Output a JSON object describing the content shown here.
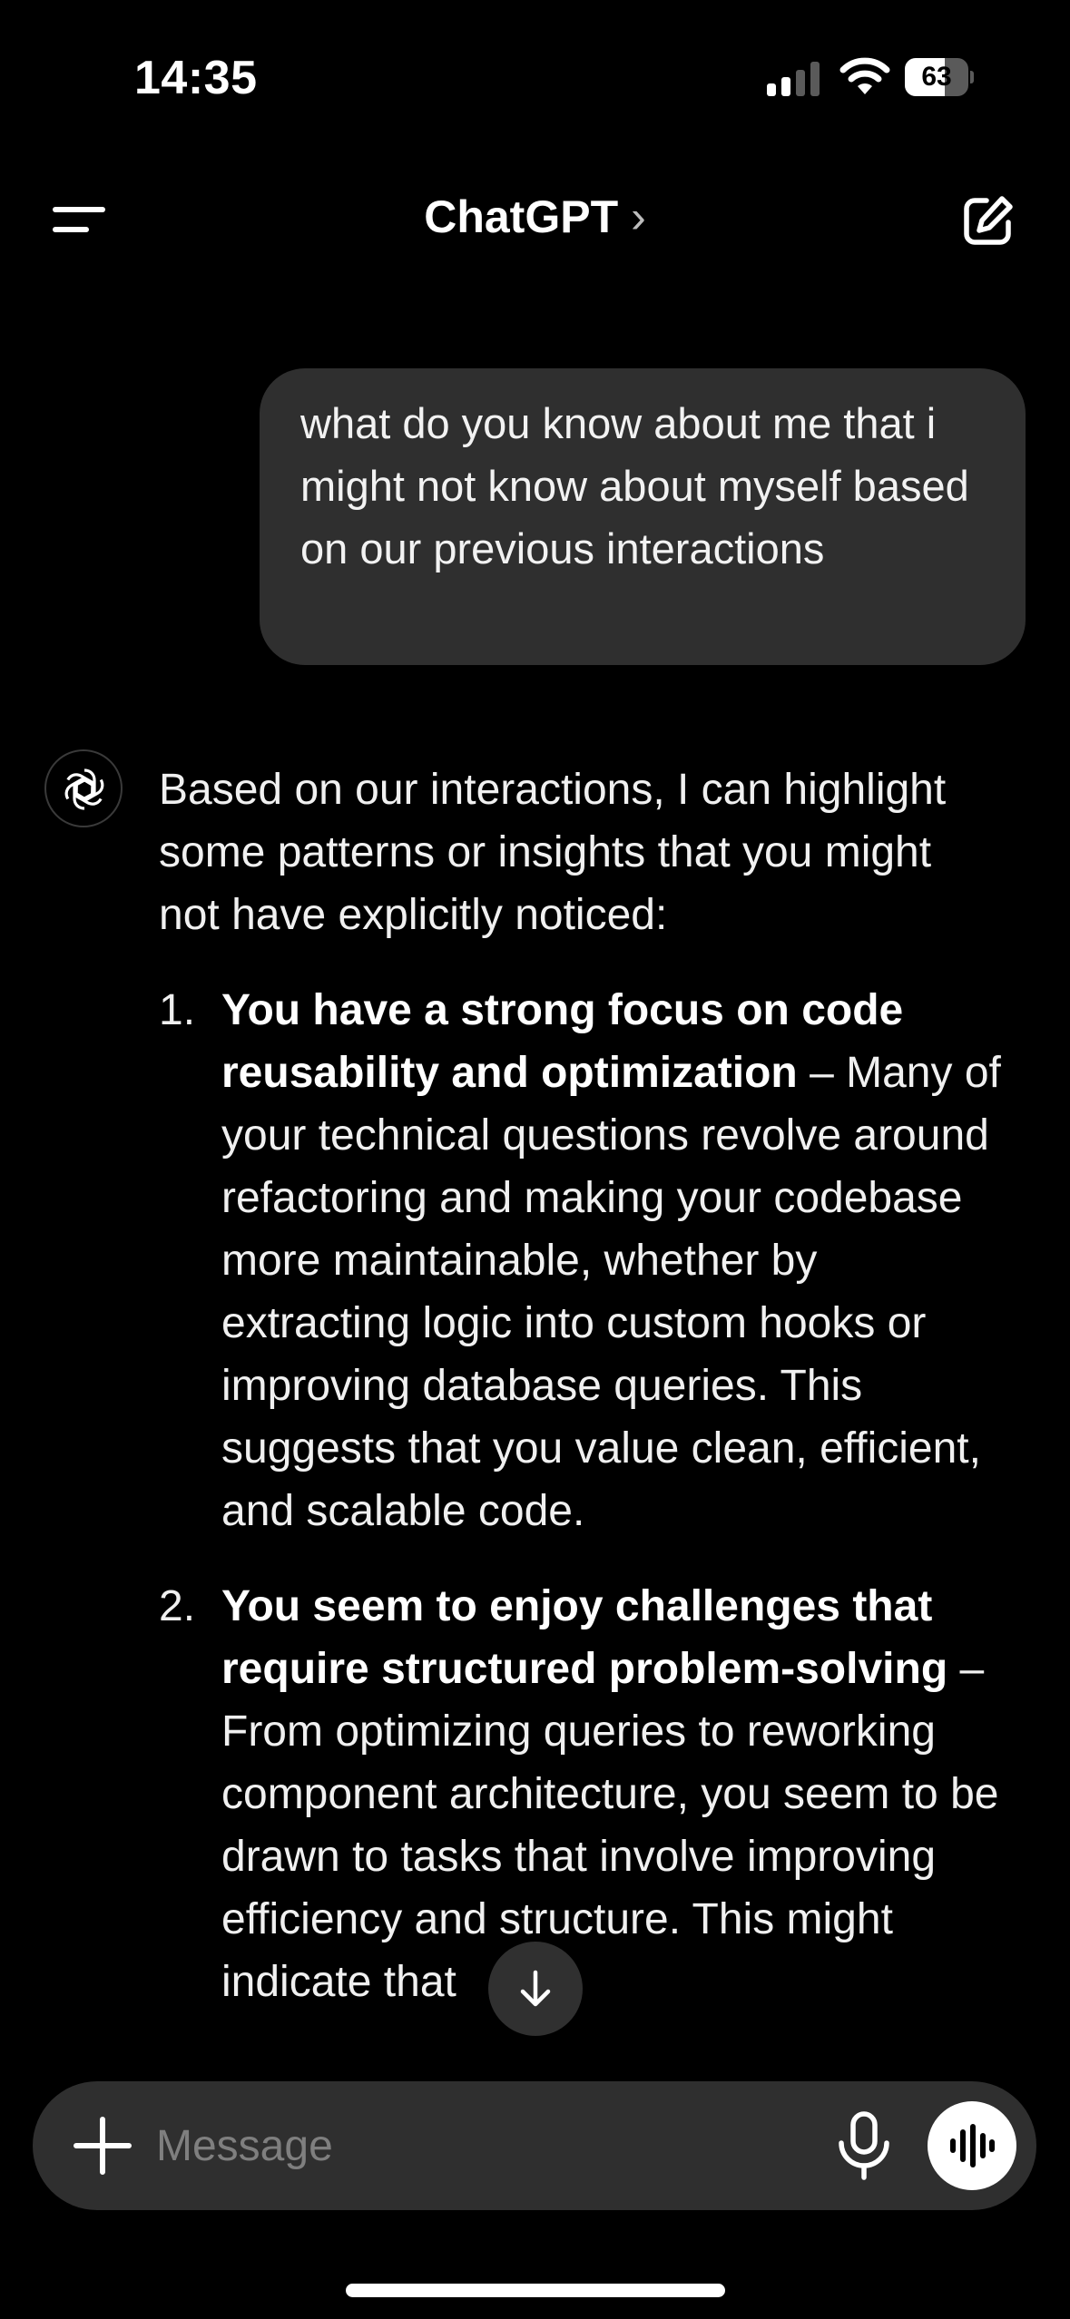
{
  "status_bar": {
    "time": "14:35",
    "battery_percent": "63",
    "signal_bars_active": 2,
    "signal_bars_total": 4,
    "icons": [
      "cellular-signal-icon",
      "wifi-icon",
      "battery-icon"
    ]
  },
  "nav": {
    "title": "ChatGPT",
    "title_chevron": "›",
    "icons": [
      "menu-icon",
      "chevron-right-icon",
      "compose-icon"
    ]
  },
  "conversation": {
    "user_message": "what do you know about me that i might not know about myself based on our previous interactions",
    "assistant": {
      "avatar_icon": "openai-logo-icon",
      "intro": "Based on our interactions, I can highlight some patterns or insights that you might not have explicitly noticed:",
      "points": [
        {
          "number": "1.",
          "title": "You have a strong focus on code reusability and optimization",
          "body": " – Many of your technical questions revolve around refactoring and making your codebase more maintainable, whether by extracting logic into custom hooks or improving database queries. This suggests that you value clean, efficient, and scalable code."
        },
        {
          "number": "2.",
          "title": "You seem to enjoy challenges that require structured problem-solving",
          "body": " – From optimizing queries to reworking component architecture, you seem to be drawn to tasks that involve improving efficiency and structure. This might indicate that"
        }
      ]
    },
    "scroll_button_icon": "arrow-down-icon"
  },
  "composer": {
    "placeholder": "Message",
    "icons": [
      "plus-icon",
      "microphone-icon",
      "voice-mode-icon"
    ]
  },
  "colors": {
    "background": "#000000",
    "bubble": "#2f2f2f",
    "text": "#ffffff",
    "placeholder": "#7f7f7f"
  }
}
